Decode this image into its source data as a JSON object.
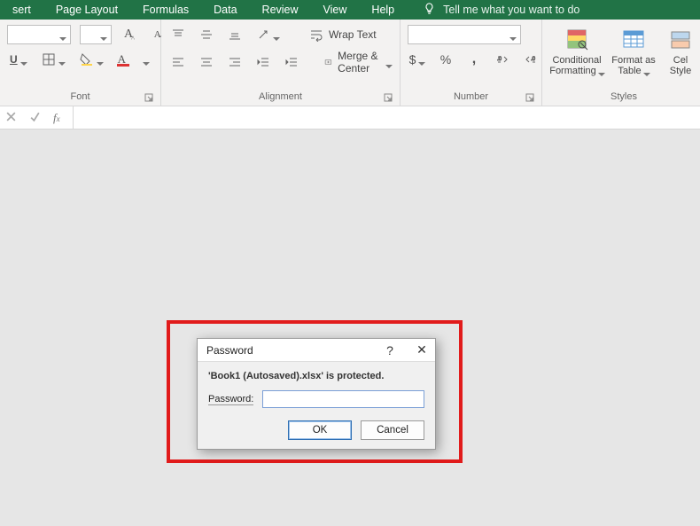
{
  "tabs": {
    "insert": "sert",
    "page_layout": "Page Layout",
    "formulas": "Formulas",
    "data": "Data",
    "review": "Review",
    "view": "View",
    "help": "Help",
    "tell_me": "Tell me what you want to do"
  },
  "ribbon": {
    "font": {
      "label": "Font",
      "underline": "U"
    },
    "alignment": {
      "label": "Alignment",
      "wrap_text": "Wrap Text",
      "merge_center": "Merge & Center"
    },
    "number": {
      "label": "Number",
      "currency": "$",
      "percent": "%",
      "comma": ",",
      "inc_dec": ".0",
      "dec_dec": ".0"
    },
    "styles": {
      "label": "Styles",
      "conditional": "Conditional\nFormatting",
      "format_as_table": "Format as\nTable",
      "cell_styles": "Cel\nStyle"
    }
  },
  "dialog": {
    "title": "Password",
    "message": "'Book1 (Autosaved).xlsx' is protected.",
    "field_label": "Password:",
    "value": "",
    "ok": "OK",
    "cancel": "Cancel",
    "help": "?",
    "close": "✕"
  }
}
